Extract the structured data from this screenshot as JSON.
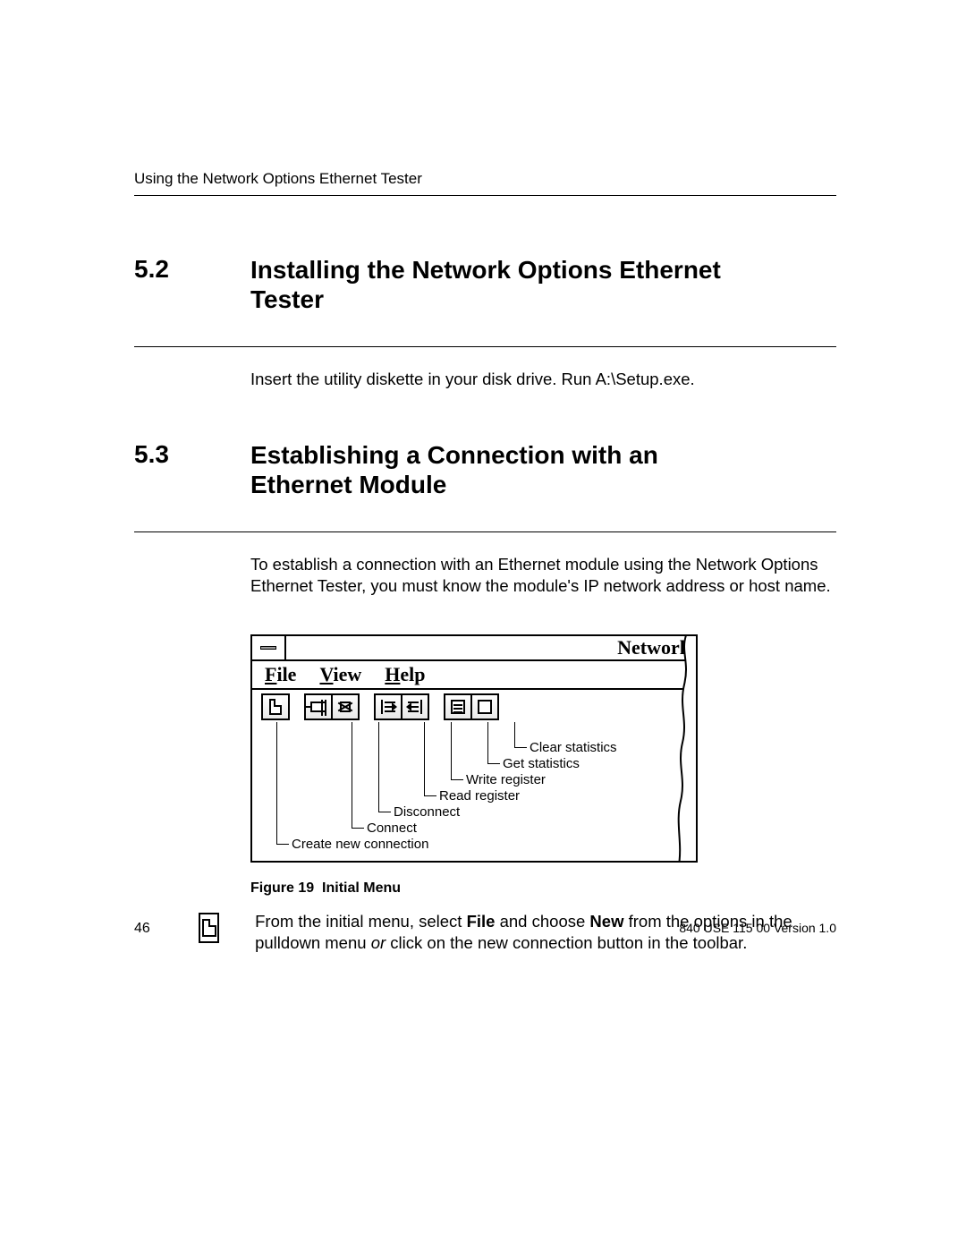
{
  "runningHeader": "Using the Network Options Ethernet Tester",
  "sections": {
    "s52": {
      "num": "5.2",
      "title": "Installing the Network Options Ethernet Tester",
      "body": "Insert the utility diskette in your disk drive. Run A:\\Setup.exe."
    },
    "s53": {
      "num": "5.3",
      "title": "Establishing a Connection with an Ethernet Module",
      "body": "To establish a connection with an Ethernet module using the Network Options Ethernet Tester, you must know the module's IP network address or host name."
    }
  },
  "figure": {
    "windowTitle": "Network",
    "menus": {
      "file": "File",
      "view": "View",
      "help": "Help"
    },
    "toolbar": {
      "new": "Create new connection",
      "connect": "Connect",
      "disconnect": "Disconnect",
      "read": "Read register",
      "write": "Write register",
      "getstats": "Get statistics",
      "clearstats": "Clear statistics"
    },
    "captionPrefix": "Figure 19",
    "captionText": "Initial Menu"
  },
  "note": {
    "prefix": "From the initial menu, select ",
    "bold1": "File",
    "mid1": " and choose ",
    "bold2": "New",
    "mid2": " from the options in the pulldown menu ",
    "italic": "or",
    "tail": " click on the new connection button in the toolbar."
  },
  "footer": {
    "pageNum": "46",
    "docId": "840 USE 115 00  Version 1.0"
  }
}
